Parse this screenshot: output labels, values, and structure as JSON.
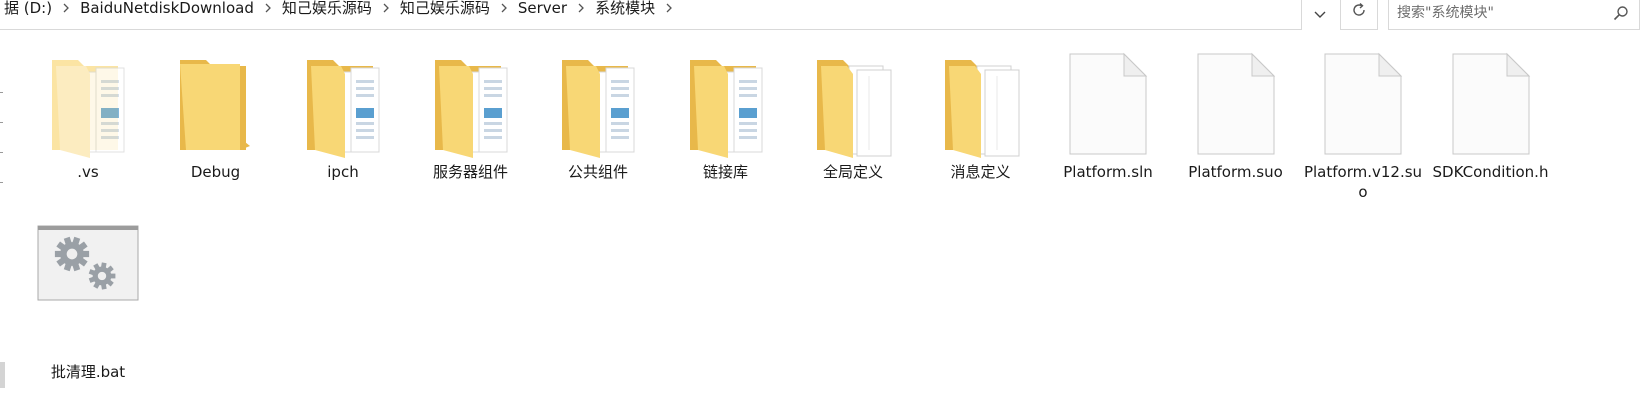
{
  "address_bar": {
    "crumbs": [
      "据 (D:)",
      "BaiduNetdiskDownload",
      "知己娱乐源码",
      "知己娱乐源码",
      "Server",
      "系统模块"
    ]
  },
  "search": {
    "placeholder": "搜索\"系统模块\""
  },
  "icons": {
    "chevron": "chevron-right-icon",
    "dropdown": "chevron-down-icon",
    "refresh": "refresh-icon",
    "search": "magnifier-icon"
  },
  "colors": {
    "folder_back": "#e8b84a",
    "folder_front": "#f8d775",
    "folder_light": "#fbe4a3",
    "doc_page": "#ffffff",
    "doc_line": "#5a9fd0",
    "file_border": "#c8c8c8",
    "gear": "#9aa0a6"
  },
  "items": [
    {
      "name": ".vs",
      "kind": "folder-docs-faded"
    },
    {
      "name": "Debug",
      "kind": "folder-empty"
    },
    {
      "name": "ipch",
      "kind": "folder-docs"
    },
    {
      "name": "服务器组件",
      "kind": "folder-docs"
    },
    {
      "name": "公共组件",
      "kind": "folder-docs"
    },
    {
      "name": "链接库",
      "kind": "folder-docs"
    },
    {
      "name": "全局定义",
      "kind": "folder-pages"
    },
    {
      "name": "消息定义",
      "kind": "folder-pages"
    },
    {
      "name": "Platform.sln",
      "kind": "file"
    },
    {
      "name": "Platform.suo",
      "kind": "file"
    },
    {
      "name": "Platform.v12.suo",
      "kind": "file"
    },
    {
      "name": "SDKCondition.h",
      "kind": "file"
    },
    {
      "name": "批清理.bat",
      "kind": "batch"
    }
  ]
}
